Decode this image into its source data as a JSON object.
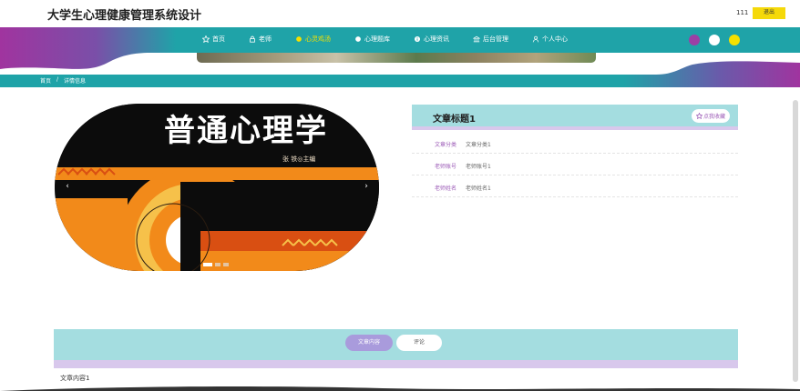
{
  "header": {
    "site_title": "大学生心理健康管理系统设计",
    "user_name": "111",
    "logout_label": "退出"
  },
  "nav": {
    "items": [
      {
        "label": "首页",
        "icon": "star-icon",
        "active": false
      },
      {
        "label": "老师",
        "icon": "lock-icon",
        "active": false
      },
      {
        "label": "心灵鸡汤",
        "icon": "circle-icon",
        "active": true
      },
      {
        "label": "心理题库",
        "icon": "circle-icon",
        "active": false
      },
      {
        "label": "心理资讯",
        "icon": "info-icon",
        "active": false
      },
      {
        "label": "后台管理",
        "icon": "bank-icon",
        "active": false
      },
      {
        "label": "个人中心",
        "icon": "user-icon",
        "active": false
      }
    ]
  },
  "theme_dots": [
    "#9b3fa5",
    "#ffffff",
    "#f5e000"
  ],
  "breadcrumb": {
    "home": "首页",
    "separator": "/",
    "current": "详情信息"
  },
  "carousel": {
    "cover_title": "普通心理学",
    "cover_editor": "张  铁◎主编",
    "prev_label": "‹",
    "next_label": "›",
    "slide_count": 3,
    "active_slide": 1
  },
  "article": {
    "title": "文章标题1",
    "favorite_label": "点我收藏",
    "fields": [
      {
        "label": "文章分类",
        "value": "文章分类1"
      },
      {
        "label": "老师账号",
        "value": "老师账号1"
      },
      {
        "label": "老师姓名",
        "value": "老师姓名1"
      }
    ]
  },
  "tabs": {
    "content_label": "文章内容",
    "comment_label": "评论"
  },
  "content": {
    "body": "文章内容1"
  },
  "colors": {
    "teal": "#1fa3a8",
    "purple": "#9b3fa5",
    "accent_yellow": "#f5e000",
    "light_teal": "#a4dde0",
    "lavender": "#d8c8ec"
  }
}
